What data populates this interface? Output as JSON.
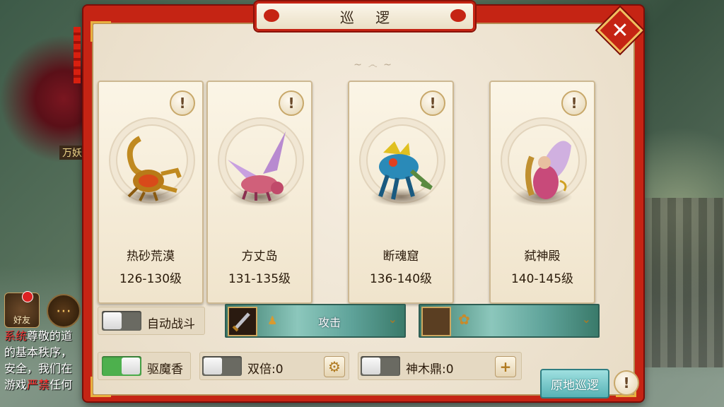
{
  "dialog": {
    "title": "巡 逻",
    "close_icon": "close-icon"
  },
  "areas": [
    {
      "name": "热砂荒漠",
      "level": "126-130级",
      "monster": "golden-scorpion"
    },
    {
      "name": "方丈岛",
      "level": "131-135级",
      "monster": "pink-winged-dragon"
    },
    {
      "name": "断魂窟",
      "level": "136-140级",
      "monster": "blue-frog-lizard"
    },
    {
      "name": "弑神殿",
      "level": "140-145级",
      "monster": "pink-winged-fairy"
    }
  ],
  "controls": {
    "auto_battle": {
      "label": "自动战斗",
      "on": false
    },
    "skill": {
      "label": "攻击"
    },
    "pet_skill": {
      "label": ""
    },
    "repel": {
      "label": "驱魔香",
      "on": true
    },
    "double": {
      "label": "双倍:0",
      "on": false
    },
    "shenmu": {
      "label": "神木鼎:0",
      "on": false
    },
    "patrol_button": "原地巡逻"
  },
  "background": {
    "friend_label": "好友",
    "npc_label": "万妖",
    "chat": [
      {
        "tag": "系统",
        "text": "尊敬的道"
      },
      {
        "text": "的基本秩序，"
      },
      {
        "text": "安全，我们在"
      },
      {
        "text": "游戏",
        "red": "严禁",
        "tail": "任何"
      }
    ]
  },
  "colors": {
    "frame_red": "#c52414",
    "panel_cream": "#ede3d0",
    "toggle_on": "#4db04d",
    "patrol_teal": "#58b3b6"
  }
}
